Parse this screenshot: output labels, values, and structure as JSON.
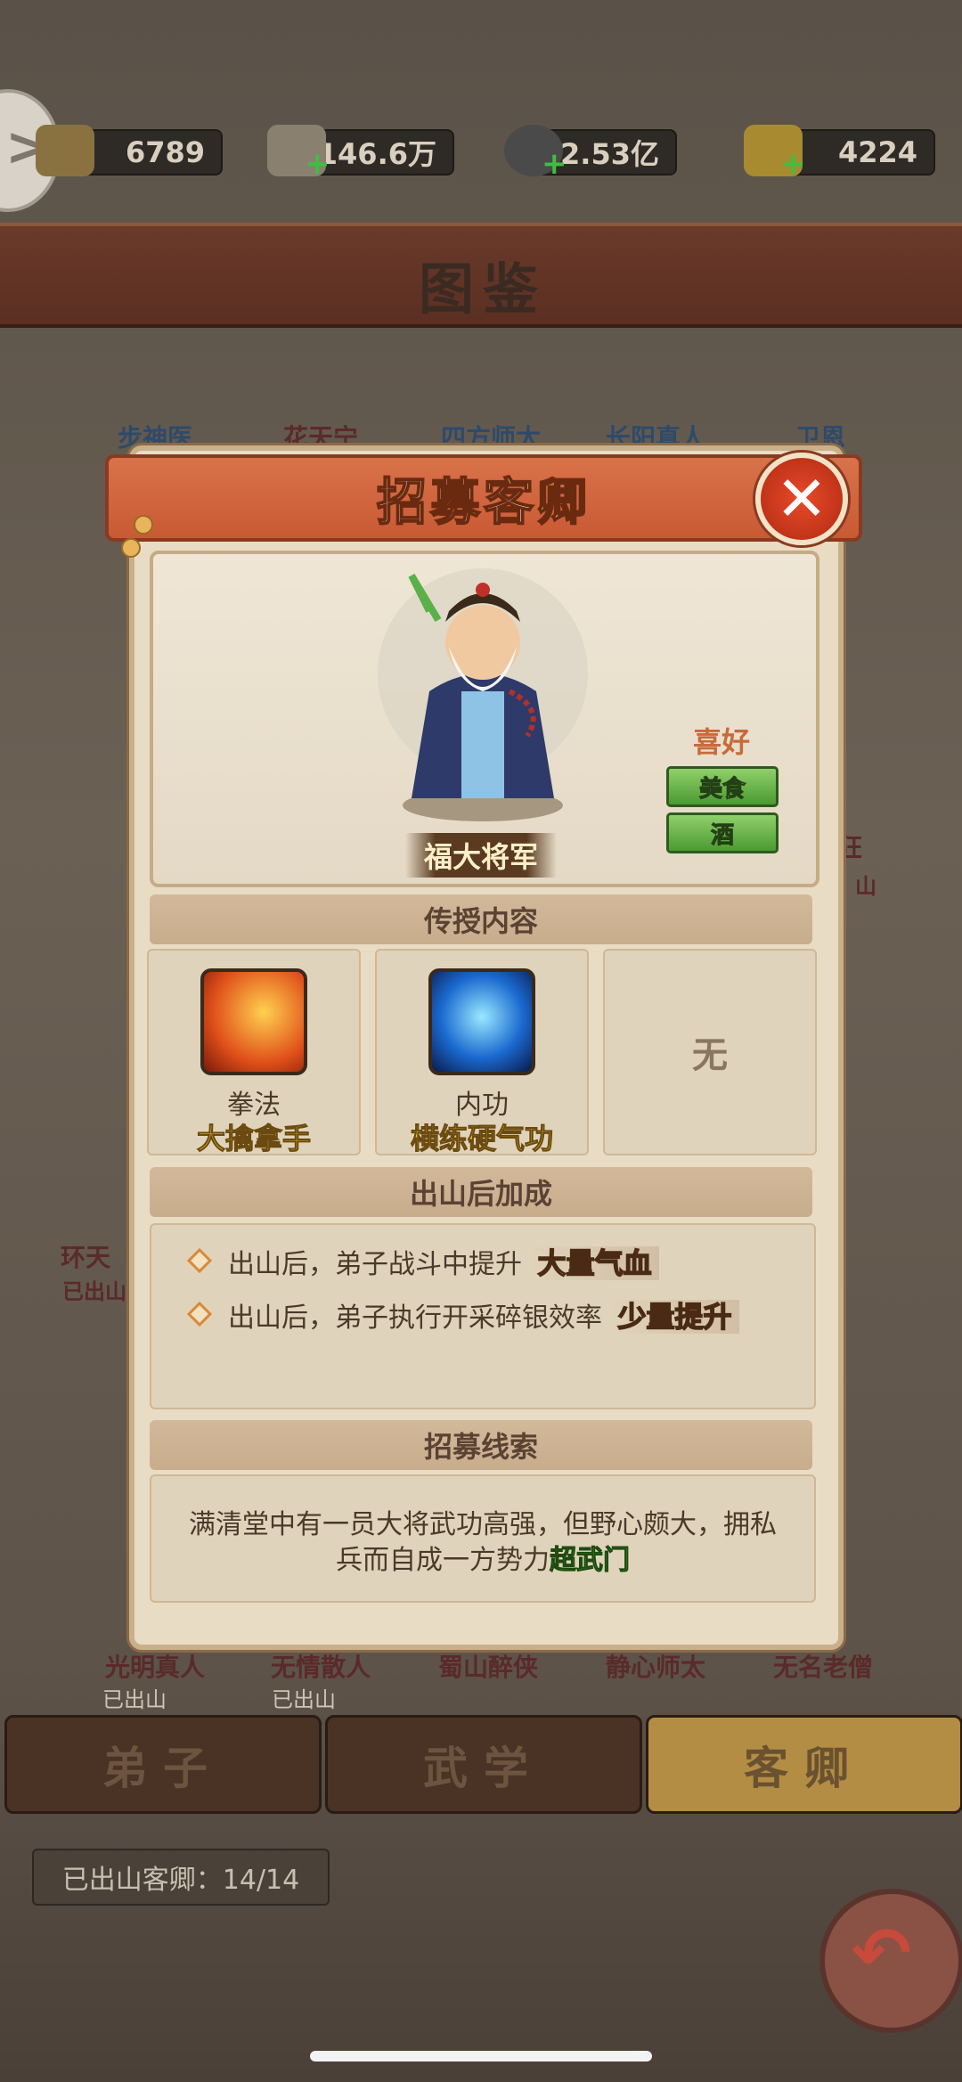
{
  "resources": [
    {
      "icon": "coin-pouch-icon",
      "value": "6789"
    },
    {
      "icon": "scroll-icon",
      "value": "146.6万"
    },
    {
      "icon": "copper-coin-icon",
      "value": "2.53亿"
    },
    {
      "icon": "gold-ingot-icon",
      "value": "4224"
    }
  ],
  "page_title": "图鉴",
  "bg_names_row1": [
    "步神医",
    "花天宁",
    "四方师太",
    "长阳真人",
    "卫恩"
  ],
  "bg_names_row_bottom": [
    "光明真人",
    "无情散人",
    "蜀山醉侠",
    "静心师太",
    "无名老僧"
  ],
  "bg_status": [
    "已出山",
    "已出山"
  ],
  "bg_side_name": "环天",
  "bg_side_status": "已出山",
  "bg_right_name": "狂",
  "bg_right_status": "山",
  "tabs": [
    "弟子",
    "武学",
    "客卿"
  ],
  "active_tab": "客卿",
  "count_text": "已出山客卿：14/14",
  "modal": {
    "title": "招募客卿",
    "character_name": "福大将军",
    "hobby_title": "喜好",
    "hobbies": [
      "美食",
      "酒"
    ],
    "teach_title": "传授内容",
    "skills": [
      {
        "type": "拳法",
        "name": "大擒拿手",
        "icon": "fist-skill-icon"
      },
      {
        "type": "内功",
        "name": "横练硬气功",
        "icon": "inner-power-skill-icon"
      }
    ],
    "empty_slot": "无",
    "bonus_title": "出山后加成",
    "bonuses": [
      {
        "text": "出山后，弟子战斗中提升",
        "tag": "大量气血"
      },
      {
        "text": "出山后，弟子执行开采碎银效率",
        "tag": "少量提升"
      }
    ],
    "clue_title": "招募线索",
    "clue_text": "满清堂中有一员大将武功高强，但野心颇大，拥私兵而自成一方势力",
    "clue_highlight": "超武门"
  },
  "colors": {
    "highlight_green": "#57d22c",
    "skill_yellow": "#f2c818",
    "header_orange": "#c85a34"
  }
}
